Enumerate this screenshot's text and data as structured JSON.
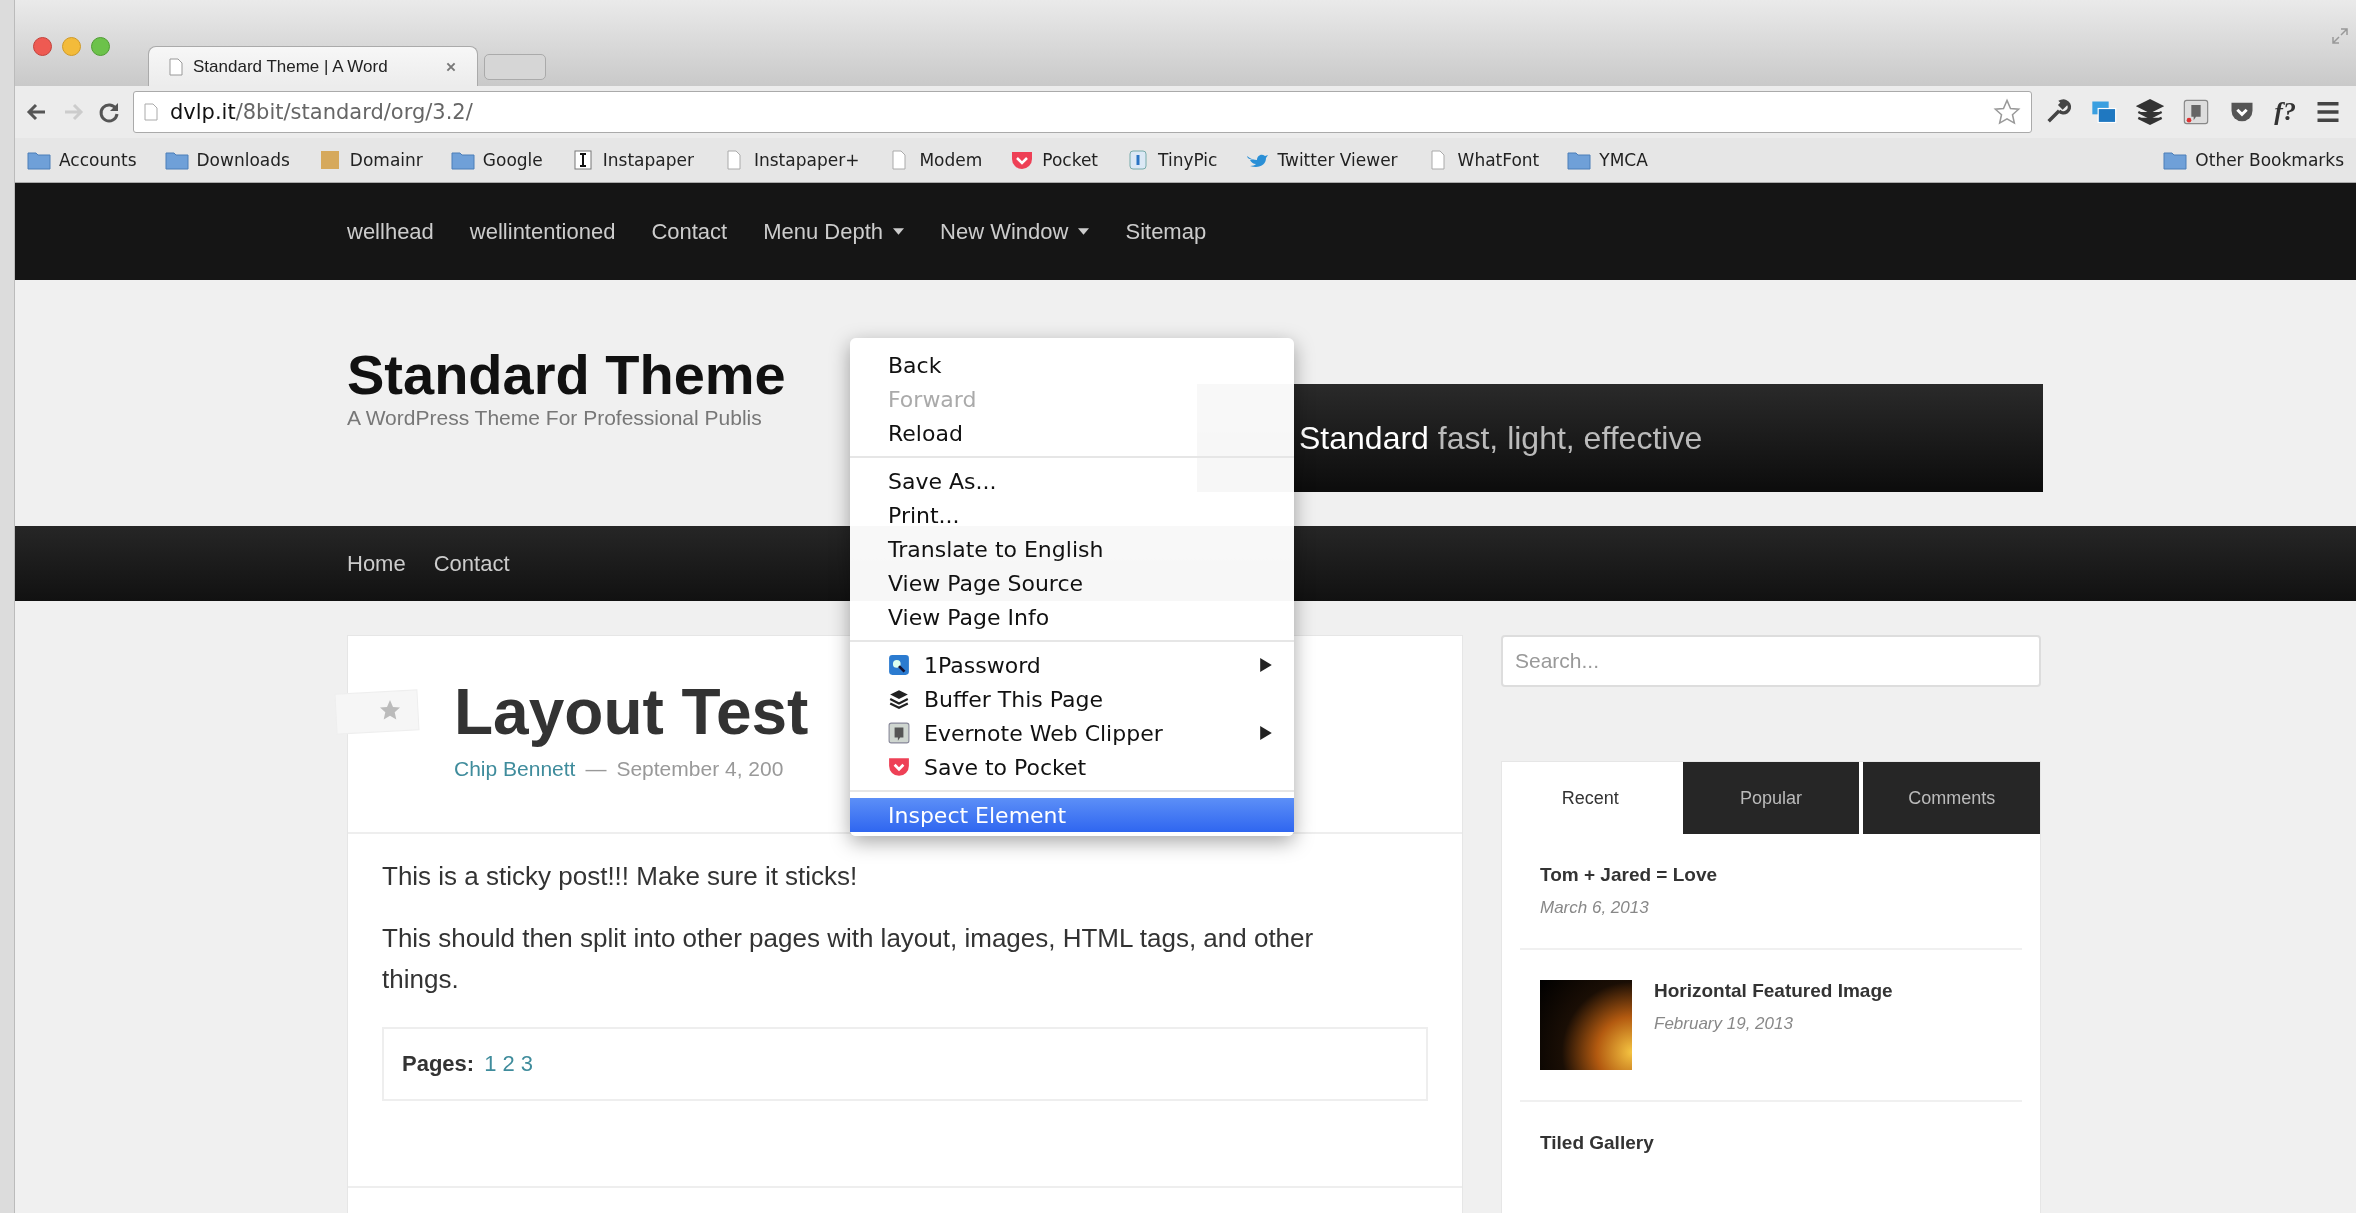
{
  "browser": {
    "tab": {
      "title": "Standard Theme | A Word",
      "selected": true
    },
    "url": {
      "host": "dvlp.it",
      "path": "/8bit/standard/org/3.2/"
    },
    "whatfont_label": "f?",
    "bookmarks": [
      {
        "label": "Accounts",
        "kind": "folder"
      },
      {
        "label": "Downloads",
        "kind": "folder"
      },
      {
        "label": "Domainr",
        "kind": "swatch"
      },
      {
        "label": "Google",
        "kind": "folder"
      },
      {
        "label": "Instapaper",
        "kind": "instapaper"
      },
      {
        "label": "Instapaper+",
        "kind": "page"
      },
      {
        "label": "Modem",
        "kind": "page"
      },
      {
        "label": "Pocket",
        "kind": "pocket"
      },
      {
        "label": "TinyPic",
        "kind": "tinypic"
      },
      {
        "label": "Twitter Viewer",
        "kind": "bird"
      },
      {
        "label": "WhatFont",
        "kind": "page"
      },
      {
        "label": "YMCA",
        "kind": "folder"
      }
    ],
    "other_bookmarks": "Other Bookmarks"
  },
  "top_nav": [
    {
      "label": "wellhead",
      "dropdown": false
    },
    {
      "label": "wellintentioned",
      "dropdown": false
    },
    {
      "label": "Contact",
      "dropdown": false
    },
    {
      "label": "Menu Depth",
      "dropdown": true
    },
    {
      "label": "New Window",
      "dropdown": true
    },
    {
      "label": "Sitemap",
      "dropdown": false
    }
  ],
  "site": {
    "title": "Standard Theme",
    "tagline": "A WordPress Theme For Professional Publis"
  },
  "banner": {
    "brand": "Standard",
    "tagline": "fast, light, effective"
  },
  "main_nav": [
    "Home",
    "Contact"
  ],
  "post": {
    "title": "Layout Test",
    "author": "Chip Bennett",
    "separator": "—",
    "date": "September 4, 200",
    "paragraphs": [
      "This is a sticky post!!! Make sure it sticks!",
      "This should then split into other pages with layout, images, HTML tags, and other things."
    ],
    "pages_label": "Pages:",
    "pages": [
      "1",
      "2",
      "3"
    ]
  },
  "sidebar": {
    "search": {
      "placeholder": "Search..."
    },
    "tabs": [
      {
        "label": "Recent",
        "selected": true
      },
      {
        "label": "Popular",
        "selected": false
      },
      {
        "label": "Comments",
        "selected": false
      }
    ],
    "posts": [
      {
        "title": "Tom + Jared = Love",
        "date": "March 6, 2013",
        "kind": "text"
      },
      {
        "title": "Horizontal Featured Image",
        "date": "February 19, 2013",
        "kind": "image"
      },
      {
        "title": "Tiled Gallery",
        "kind": "text"
      }
    ]
  },
  "context_menu": {
    "groups": [
      [
        {
          "label": "Back",
          "disabled": false,
          "submenu": false,
          "selected": false
        },
        {
          "label": "Forward",
          "disabled": true,
          "submenu": false,
          "selected": false
        },
        {
          "label": "Reload",
          "disabled": false,
          "submenu": false,
          "selected": false
        }
      ],
      [
        {
          "label": "Save As...",
          "disabled": false,
          "submenu": false,
          "selected": false
        },
        {
          "label": "Print...",
          "disabled": false,
          "submenu": false,
          "selected": false
        },
        {
          "label": "Translate to English",
          "disabled": false,
          "submenu": false,
          "selected": false
        },
        {
          "label": "View Page Source",
          "disabled": false,
          "submenu": false,
          "selected": false
        },
        {
          "label": "View Page Info",
          "disabled": false,
          "submenu": false,
          "selected": false
        }
      ],
      [
        {
          "label": "1Password",
          "kind": "extension",
          "disabled": false,
          "submenu": true,
          "selected": false
        },
        {
          "label": "Buffer This Page",
          "kind": "extension",
          "disabled": false,
          "submenu": false,
          "selected": false
        },
        {
          "label": "Evernote Web Clipper",
          "kind": "extension",
          "disabled": false,
          "submenu": true,
          "selected": false
        },
        {
          "label": "Save to Pocket",
          "kind": "extension",
          "disabled": false,
          "submenu": false,
          "selected": false
        }
      ],
      [
        {
          "label": "Inspect Element",
          "disabled": false,
          "submenu": false,
          "selected": true
        }
      ]
    ]
  }
}
